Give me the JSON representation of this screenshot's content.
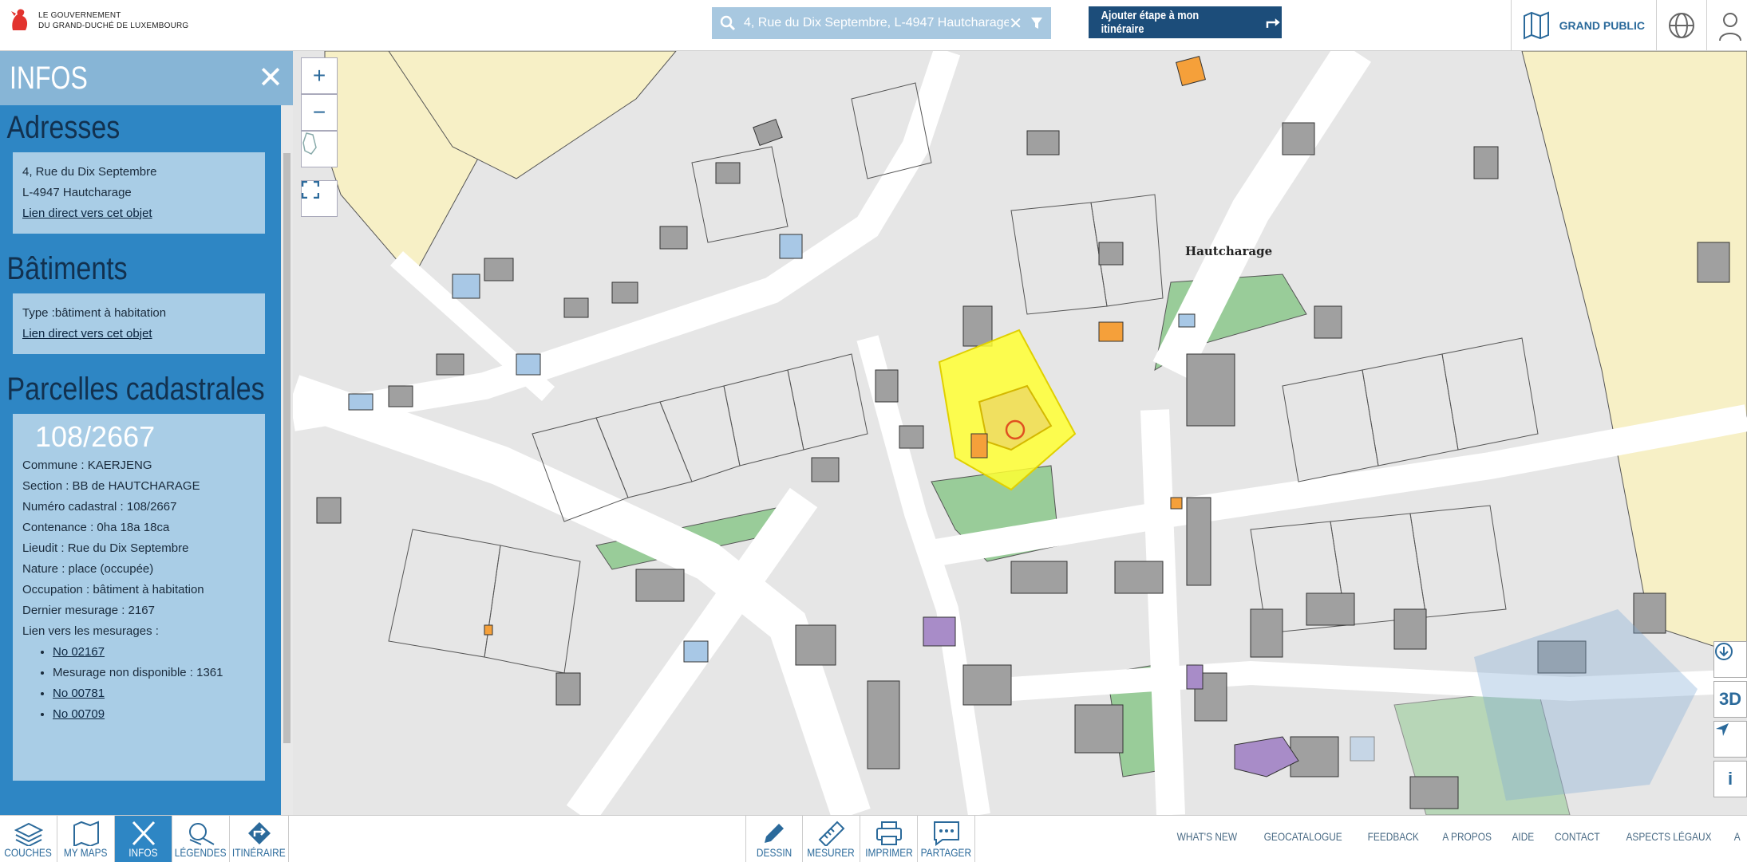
{
  "header": {
    "logo_line1": "LE GOUVERNEMENT",
    "logo_line2": "DU GRAND-DUCHÉ DE LUXEMBOURG",
    "search_value": "4, Rue du Dix Septembre, L-4947 Hautcharage",
    "add_button": "Ajouter étape à mon itinéraire",
    "grand_public": "GRAND PUBLIC"
  },
  "sidebar": {
    "title": "INFOS",
    "adresses": {
      "title": "Adresses",
      "line1": "4, Rue du Dix Septembre",
      "line2": "L-4947 Hautcharage",
      "link": "Lien direct vers cet objet"
    },
    "batiments": {
      "title": "Bâtiments",
      "type": "Type :bâtiment à habitation",
      "link": "Lien direct vers cet objet"
    },
    "parcelles": {
      "title": "Parcelles cadastrales",
      "id": "108/2667",
      "commune": "Commune : KAERJENG",
      "section": "Section : BB de HAUTCHARAGE",
      "numero": "Numéro cadastral : 108/2667",
      "contenance": "Contenance : 0ha 18a 18ca",
      "lieudit": "Lieudit : Rue du Dix Septembre",
      "nature": "Nature : place (occupée)",
      "occupation": "Occupation : bâtiment à habitation",
      "dernier": "Dernier mesurage : 2167",
      "lien_mesurages": "Lien vers les mesurages :",
      "mesurages": [
        "No 02167",
        "Mesurage non disponible : 1361",
        "No 00781",
        "No 00709"
      ]
    }
  },
  "map": {
    "place_label": "Hautcharage",
    "zoom_in": "+",
    "zoom_out": "−",
    "btn_3d": "3D",
    "btn_info": "i"
  },
  "footer": {
    "tabs": [
      "COUCHES",
      "MY MAPS",
      "INFOS",
      "LÉGENDES",
      "ITINÉRAIRE"
    ],
    "tools": [
      "DESSIN",
      "MESURER",
      "IMPRIMER",
      "PARTAGER"
    ],
    "links": [
      "WHAT'S NEW",
      "GEOCATALOGUE",
      "FEEDBACK",
      "A PROPOS",
      "AIDE",
      "CONTACT",
      "ASPECTS LÉGAUX",
      "A"
    ]
  },
  "colors": {
    "sidebar": "#2e86c4",
    "highlight": "#ffff33",
    "building": "#a0a0a0",
    "green": "#99cc99",
    "yellow_area": "#f7f0c6"
  }
}
